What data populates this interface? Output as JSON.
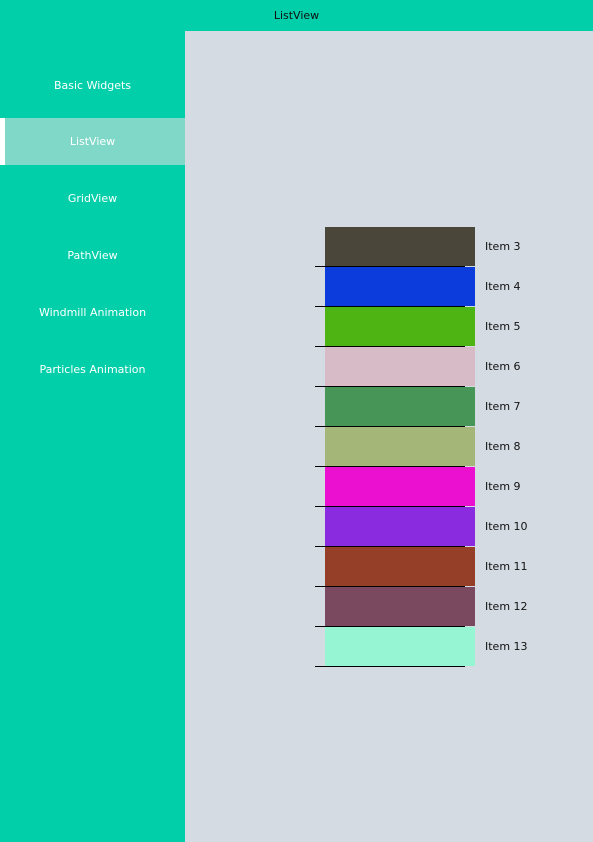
{
  "window": {
    "title": "ListView"
  },
  "sidebar": {
    "items": [
      {
        "label": "Basic Widgets",
        "active": false
      },
      {
        "label": "ListView",
        "active": true
      },
      {
        "label": "GridView",
        "active": false
      },
      {
        "label": "PathView",
        "active": false
      },
      {
        "label": "Windmill Animation",
        "active": false
      },
      {
        "label": "Particles Animation",
        "active": false
      }
    ]
  },
  "colors": {
    "accent": "#00cfa9",
    "active_item": "#7fd8c8",
    "content_bg": "#d4dbe3"
  },
  "list": {
    "items": [
      {
        "label": "Item 3",
        "color": "#4a463a"
      },
      {
        "label": "Item 4",
        "color": "#0c3ddc"
      },
      {
        "label": "Item 5",
        "color": "#4eb414"
      },
      {
        "label": "Item 6",
        "color": "#d7bbc7"
      },
      {
        "label": "Item 7",
        "color": "#489558"
      },
      {
        "label": "Item 8",
        "color": "#a5b778"
      },
      {
        "label": "Item 9",
        "color": "#eb10cf"
      },
      {
        "label": "Item 10",
        "color": "#8b2be0"
      },
      {
        "label": "Item 11",
        "color": "#953f28"
      },
      {
        "label": "Item 12",
        "color": "#7b495f"
      },
      {
        "label": "Item 13",
        "color": "#96f5d3"
      }
    ]
  }
}
